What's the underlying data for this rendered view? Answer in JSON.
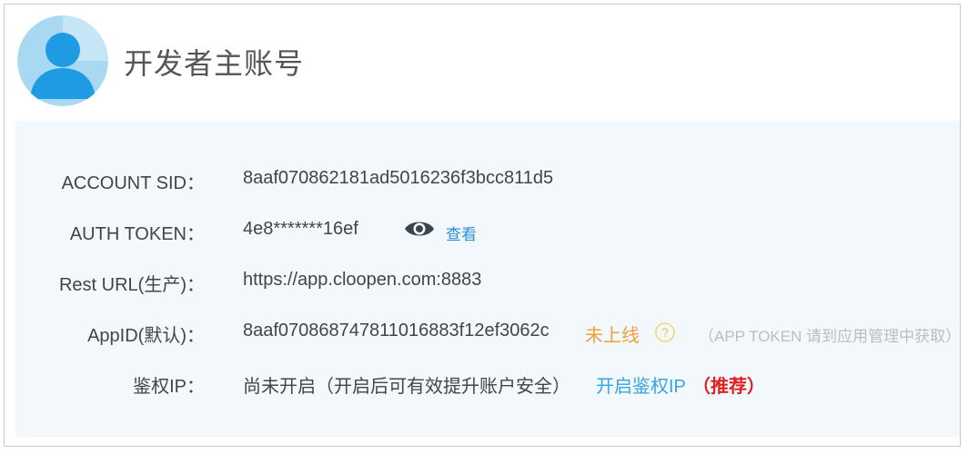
{
  "header": {
    "title": "开发者主账号",
    "avatar_icon": "user-avatar-icon"
  },
  "colors": {
    "link": "#2b8fd9",
    "offline": "#f0a03c",
    "recommend": "#e02020",
    "panel_bg": "#f3f8fc"
  },
  "fields": {
    "account_sid": {
      "label": "ACCOUNT SID：",
      "value": "8aaf070862181ad5016236f3bcc811d5"
    },
    "auth_token": {
      "label": "AUTH TOKEN：",
      "value": "4e8*******16ef",
      "view_label": "查看",
      "eye_icon": "eye-icon"
    },
    "rest_url": {
      "label": "Rest URL(生产)：",
      "value": "https://app.cloopen.com:8883"
    },
    "app_id": {
      "label": "AppID(默认)：",
      "value": "8aaf070868747811016883f12ef3062c",
      "status": "未上线",
      "help_icon": "question-icon",
      "note": "（APP TOKEN 请到应用管理中获取）"
    },
    "auth_ip": {
      "label": "鉴权IP：",
      "value": "尚未开启（开启后可有效提升账户安全）",
      "enable_label": "开启鉴权IP",
      "recommend_label": "（推荐）"
    }
  }
}
